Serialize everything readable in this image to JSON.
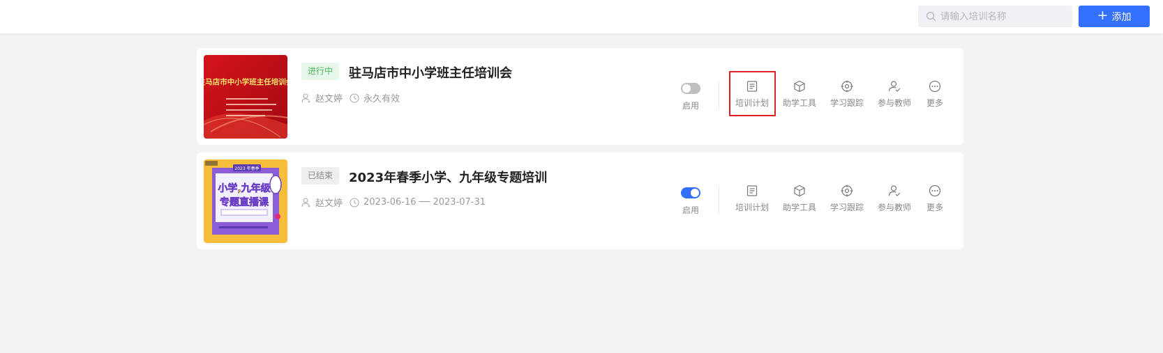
{
  "header": {
    "search_placeholder": "请输入培训名称",
    "add_label": "添加",
    "accent_color": "#3370ff"
  },
  "trainings": [
    {
      "status": "进行中",
      "title": "驻马店市中小学班主任培训会",
      "author": "赵文婷",
      "period": "永久有效",
      "enabled": false,
      "toggle_label": "启用",
      "thumb_title": "驻马店市中小学班主任培训会",
      "actions": [
        "培训计划",
        "助学工具",
        "学习跟踪",
        "参与教师",
        "更多"
      ]
    },
    {
      "status": "已结束",
      "title": "2023年春季小学、九年级专题培训",
      "author": "赵文婷",
      "period": "2023-06-16 ── 2023-07-31",
      "enabled": true,
      "toggle_label": "启用",
      "thumb_title_1": "小学,九年级",
      "thumb_title_2": "专题直播课",
      "thumb_top": "2023 年春季",
      "actions": [
        "培训计划",
        "助学工具",
        "学习跟踪",
        "参与教师",
        "更多"
      ]
    }
  ]
}
